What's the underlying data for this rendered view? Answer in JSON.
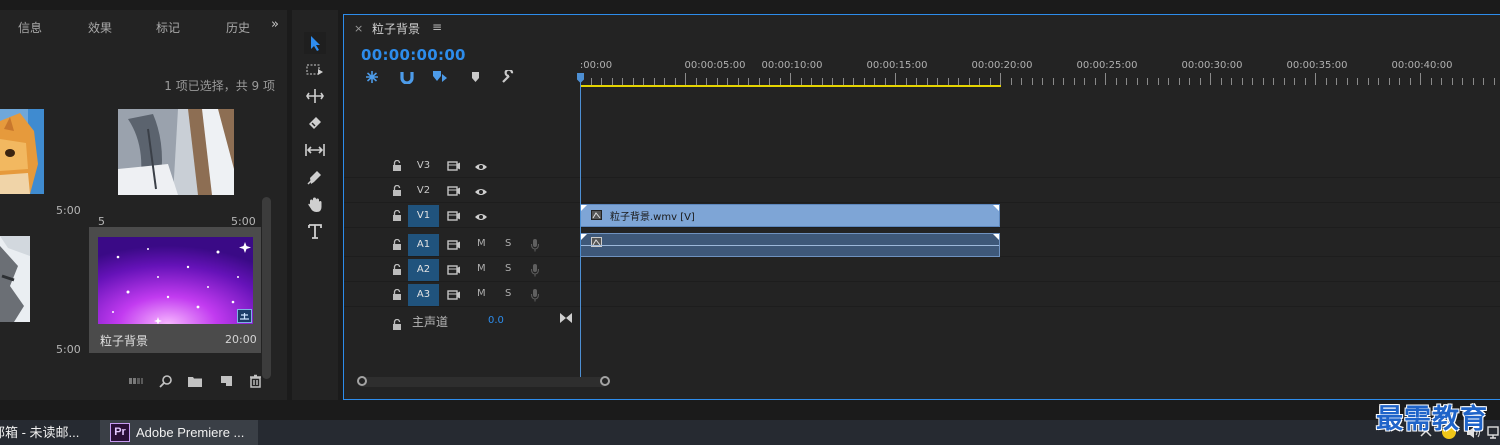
{
  "project_panel": {
    "tabs": [
      "信息",
      "效果",
      "标记",
      "历史"
    ],
    "more_glyph": "»",
    "selection_info": "1 项已选择，共 9 项",
    "items": [
      {
        "name": "",
        "duration": "5:00"
      },
      {
        "name": "5",
        "duration": "5:00"
      },
      {
        "name": "",
        "duration": "5:00"
      },
      {
        "name": "粒子背景",
        "duration": "20:00",
        "selected": true
      }
    ],
    "bottom_tools": [
      "list-view-icon",
      "search-icon",
      "new-bin-icon",
      "new-item-icon",
      "trash-icon"
    ]
  },
  "tools": [
    "selection-tool-icon",
    "track-select-tool-icon",
    "ripple-edit-tool-icon",
    "razor-tool-icon",
    "slip-tool-icon",
    "pen-tool-icon",
    "hand-tool-icon",
    "type-tool-icon"
  ],
  "timeline": {
    "close_glyph": "×",
    "title": "粒子背景",
    "menu_glyph": "≡",
    "timecode": "00:00:00:00",
    "tools": [
      "snap-icon",
      "linked-selection-icon",
      "add-marker-icon",
      "marker-icon",
      "wrench-icon"
    ],
    "ruler_labels": [
      ":00:00",
      "00:00:05:00",
      "00:00:10:00",
      "00:00:15:00",
      "00:00:20:00",
      "00:00:25:00",
      "00:00:30:00",
      "00:00:35:00",
      "00:00:40:00"
    ],
    "video_tracks": [
      {
        "name": "V3",
        "targeted": false
      },
      {
        "name": "V2",
        "targeted": false
      },
      {
        "name": "V1",
        "targeted": true
      }
    ],
    "audio_tracks": [
      {
        "name": "A1",
        "mute": "M",
        "solo": "S"
      },
      {
        "name": "A2",
        "mute": "M",
        "solo": "S"
      },
      {
        "name": "A3",
        "mute": "M",
        "solo": "S"
      }
    ],
    "video_clip": "粒子背景.wmv [V]",
    "master_label": "主声道",
    "master_value": "0.0",
    "colors": {
      "accent": "#2d8ceb",
      "work_area": "#e5d400",
      "video_clip": "#7ea5d6",
      "audio_clip": "#3e5879",
      "track_target": "#20537d"
    }
  },
  "taskbar": {
    "item1": "邮箱 - 未读邮...",
    "item2": "Adobe Premiere ...",
    "pr_logo": "Pr"
  },
  "watermark": "最需教育"
}
